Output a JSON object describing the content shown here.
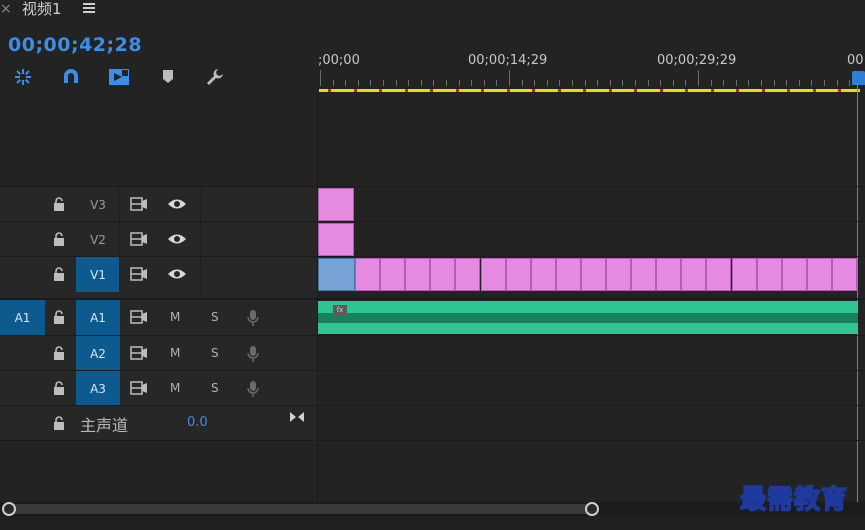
{
  "panel": {
    "close_glyph": "×",
    "title": "视频1",
    "menu_icon": "hamburger-menu-icon",
    "timecode": "00;00;42;28"
  },
  "toolbar": {
    "tools": [
      {
        "name": "nest-sequence-icon"
      },
      {
        "name": "snap-magnet-icon"
      },
      {
        "name": "linked-selection-icon"
      },
      {
        "name": "add-marker-icon"
      },
      {
        "name": "settings-wrench-icon"
      }
    ]
  },
  "ruler": {
    "labels": [
      ";00;00",
      "00;00;14;29",
      "00;00;29;29",
      "00"
    ]
  },
  "tracks": {
    "video": [
      {
        "name": "V3",
        "active": false
      },
      {
        "name": "V2",
        "active": false
      },
      {
        "name": "V1",
        "active": true
      }
    ],
    "audio": [
      {
        "name": "A1",
        "source_patch": "A1",
        "m": "M",
        "s": "S"
      },
      {
        "name": "A2",
        "m": "M",
        "s": "S"
      },
      {
        "name": "A3",
        "m": "M",
        "s": "S"
      }
    ],
    "master": {
      "label": "主声道",
      "value": "0.0"
    }
  },
  "clips": {
    "fx_label": "fx"
  },
  "watermark": "最需教育",
  "colors": {
    "accent_blue": "#3a8ee6",
    "video_clip": "#e58ae0",
    "audio_clip": "#2fc493",
    "work_area": "#e8e000"
  }
}
